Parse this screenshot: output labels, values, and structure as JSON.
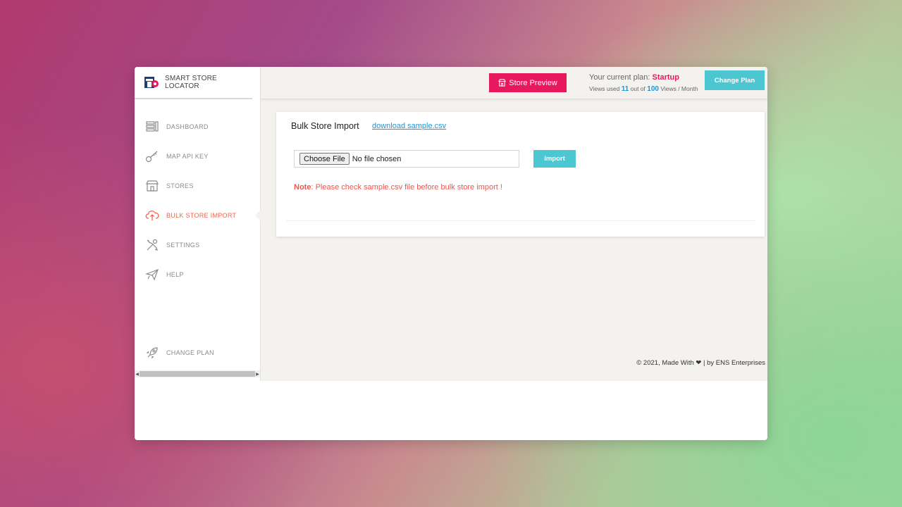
{
  "brand": {
    "name": "SMART STORE LOCATOR",
    "logo": "store-pin-logo"
  },
  "sidebar": {
    "items": [
      {
        "label": "DASHBOARD",
        "icon": "dashboard-icon"
      },
      {
        "label": "MAP API KEY",
        "icon": "key-icon"
      },
      {
        "label": "STORES",
        "icon": "store-icon"
      },
      {
        "label": "BULK STORE IMPORT",
        "icon": "cloud-upload-icon",
        "active": true
      },
      {
        "label": "SETTINGS",
        "icon": "tools-icon"
      },
      {
        "label": "HELP",
        "icon": "paper-plane-icon"
      }
    ],
    "bottom_item": {
      "label": "CHANGE PLAN",
      "icon": "rocket-icon"
    }
  },
  "topbar": {
    "preview_label": "Store Preview",
    "plan_prefix": "Your current plan: ",
    "plan_name": "Startup",
    "views_prefix": "Views used ",
    "views_used": "11",
    "views_mid": " out of ",
    "views_total": "100",
    "views_suffix": " Views / Month",
    "change_plan_label": "Change Plan"
  },
  "import_card": {
    "title": "Bulk Store Import",
    "sample_link": "download sample.csv",
    "choose_file_label": "Choose File",
    "file_status": "No file chosen",
    "import_label": "Import",
    "note_label": "Note",
    "note_text": ": Please check sample.csv file before bulk store import !"
  },
  "footer": {
    "text": "© 2021, Made With ❤ | by ENS Enterprises"
  },
  "colors": {
    "accent_pink": "#e8185f",
    "accent_teal": "#4cc6d1",
    "link_blue": "#1e96d8",
    "active_orange": "#f0654a",
    "note_red": "#f0544f"
  }
}
